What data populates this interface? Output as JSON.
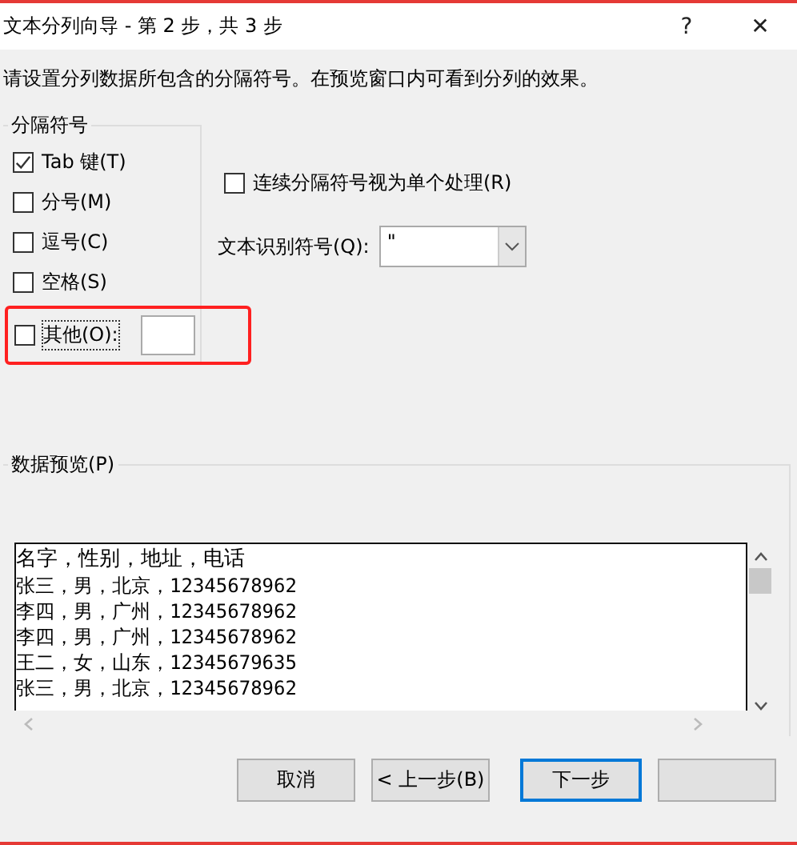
{
  "window": {
    "title": "文本分列向导 - 第 2 步，共 3 步",
    "help": "?",
    "close": "✕"
  },
  "instruction": "请设置分列数据所包含的分隔符号。在预览窗口内可看到分列的效果。",
  "delimiters": {
    "title": "分隔符号",
    "items": [
      {
        "label": "Tab 键(T)",
        "checked": true,
        "kind": "check"
      },
      {
        "label": "分号(M)",
        "checked": false,
        "kind": "check"
      },
      {
        "label": "逗号(C)",
        "checked": false,
        "kind": "check"
      },
      {
        "label": "空格(S)",
        "checked": false,
        "kind": "check"
      },
      {
        "label": "其他(O):",
        "checked": false,
        "kind": "other",
        "highlighted": true
      }
    ]
  },
  "consecutive": {
    "label": "连续分隔符号视为单个处理(R)",
    "checked": false
  },
  "qualifier": {
    "label": "文本识别符号(Q):",
    "value": "\""
  },
  "preview": {
    "title": "数据预览(P)",
    "rows": [
      "名字，性别，地址，电话",
      "张三，男，北京，12345678962",
      "李四，男，广州，12345678962",
      "李四，男，广州，12345678962",
      "王二，女，山东，12345679635",
      "张三，男，北京，12345678962"
    ]
  },
  "buttons": [
    {
      "label": "取消",
      "default": false
    },
    {
      "label": "< 上一步(B)",
      "default": false
    },
    {
      "label": "下一步",
      "default": true
    },
    {
      "default": false
    }
  ]
}
